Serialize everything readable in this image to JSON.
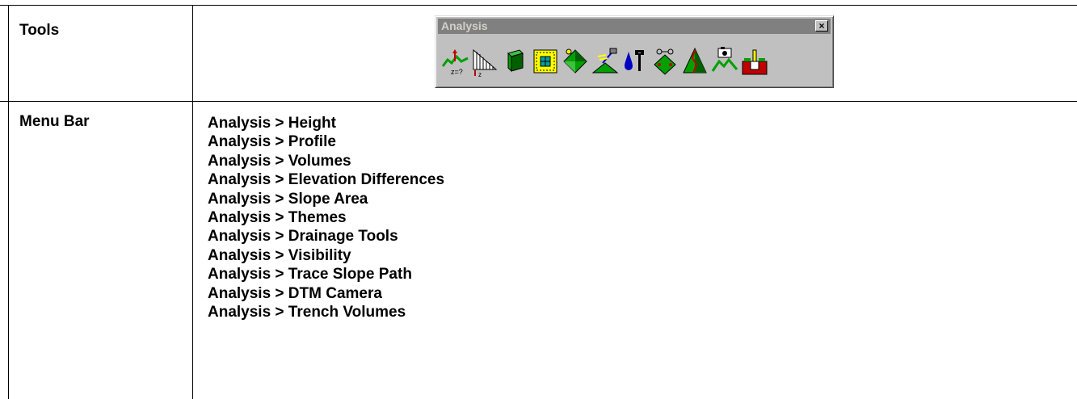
{
  "rows": [
    {
      "label": "Tools"
    },
    {
      "label": "Menu Bar"
    }
  ],
  "toolbar": {
    "title": "Analysis",
    "close_glyph": "×",
    "icons": [
      "height-icon",
      "profile-icon",
      "volumes-icon",
      "elevation-differences-icon",
      "slope-area-icon",
      "themes-icon",
      "drainage-tools-icon",
      "visibility-icon",
      "trace-slope-path-icon",
      "dtm-camera-icon",
      "trench-volumes-icon"
    ]
  },
  "menu_items": [
    "Analysis > Height",
    "Analysis > Profile",
    "Analysis > Volumes",
    "Analysis > Elevation Differences",
    "Analysis > Slope Area",
    "Analysis > Themes",
    "Analysis > Drainage Tools",
    "Analysis > Visibility",
    "Analysis > Trace Slope Path",
    "Analysis > DTM Camera",
    "Analysis > Trench Volumes"
  ],
  "colors": {
    "green": "#00a000",
    "dark_green": "#006000",
    "blue": "#0000c0",
    "red": "#c00000",
    "yellow": "#ffff00",
    "toolbar_gray": "#c0c0c0",
    "title_gray": "#808080"
  }
}
